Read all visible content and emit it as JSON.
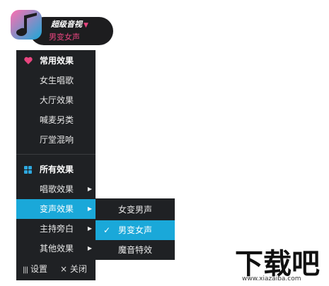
{
  "widget": {
    "title": "超级音视",
    "subtitle": "男变女声",
    "caret": "▼"
  },
  "menu": {
    "section1": {
      "label": "常用效果",
      "icon": "heart-icon"
    },
    "common_items": [
      "女生唱歌",
      "大厅效果",
      "喊麦另类",
      "厅堂混响"
    ],
    "section2": {
      "label": "所有效果",
      "icon": "grid-icon"
    },
    "all_items": [
      {
        "label": "唱歌效果",
        "has_submenu": true
      },
      {
        "label": "变声效果",
        "has_submenu": true,
        "active": true
      },
      {
        "label": "主持旁白",
        "has_submenu": true
      },
      {
        "label": "其他效果",
        "has_submenu": true
      }
    ],
    "footer": {
      "settings": "设置",
      "close": "关闭"
    }
  },
  "submenu": {
    "items": [
      "女变男声",
      "男变女声",
      "魔音特效"
    ],
    "selected": "男变女声"
  },
  "watermark": {
    "logo_text": "下载吧",
    "url": "www.xiazaiba.com"
  },
  "colors": {
    "menu_bg": "#1f2124",
    "accent": "#1aa8d9",
    "pink": "#e8457f"
  }
}
